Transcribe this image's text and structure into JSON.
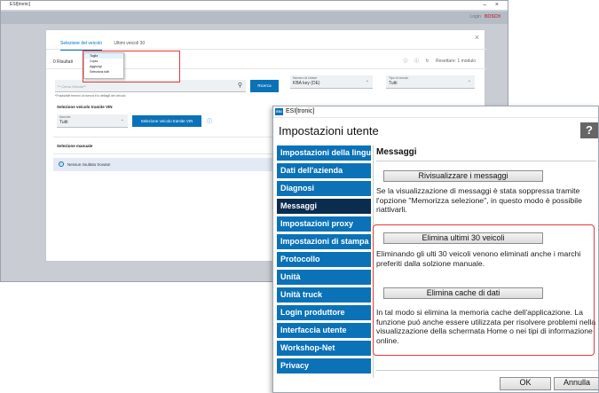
{
  "bg_window": {
    "title": "ESI[tronic]",
    "appbar_right": "Login",
    "brand": "BOSCH",
    "dialog": {
      "tabs": [
        "Selezione del veicolo",
        "Ultimi veicoli 30"
      ],
      "results": "0 Risultati",
      "reset_label": "Resettare: 1 modulo",
      "search_placeholder": "** Cerca Veicolo**",
      "search_hint": "*Posásibile termini di ricerca e/o dettagli del veicolo",
      "search_button": "Ricerca",
      "kba_label": "Numero di chiave",
      "kba_value": "KBA key (DE)",
      "type_label": "Tipo di veicolo",
      "type_value": "Tutti",
      "vin_section": "Selezione veicolo tramite VIN",
      "brand_label": "Marchio",
      "brand_value": "Tutti",
      "vin_button": "Selezione veicolo tramite VIN",
      "manual_section": "Selezione manuale",
      "no_result": "Nessun risultato trovato!",
      "context_menu": [
        "Taglia",
        "Copia",
        "Aggiungi",
        "Seleziona tutti"
      ]
    }
  },
  "settings": {
    "window_title": "ESI[tronic]",
    "app_icon": "ESI",
    "heading": "Impostazioni utente",
    "help": "?",
    "nav": [
      {
        "label": "Impostazioni della lingua",
        "active": false
      },
      {
        "label": "Dati dell'azienda",
        "active": false
      },
      {
        "label": "Diagnosi",
        "active": false
      },
      {
        "label": "Messaggi",
        "active": true
      },
      {
        "label": "Impostazioni proxy",
        "active": false
      },
      {
        "label": "Impostazioni di stampa",
        "active": false
      },
      {
        "label": "Protocollo",
        "active": false
      },
      {
        "label": "Unità",
        "active": false
      },
      {
        "label": "Unità truck",
        "active": false
      },
      {
        "label": "Login produttore",
        "active": false
      },
      {
        "label": "Interfaccia utente",
        "active": false
      },
      {
        "label": "Workshop-Net",
        "active": false
      },
      {
        "label": "Privacy",
        "active": false
      }
    ],
    "content": {
      "title": "Messaggi",
      "btn_show_messages": "Rivisualizzare i messaggi",
      "desc_show_messages": "Se la visualizzazione di messaggi è stata soppressa tramite l'opzione \"Memorizza selezione\", in questo modo è possibile riattivarli.",
      "btn_delete_vehicles": "Elimina ultimi 30 veicoli",
      "desc_delete_vehicles": "Eliminando gli ulti 30 veicoli venono eliminati anche i marchi preferiti dalla solzione manuale.",
      "btn_delete_cache": "Elimina cache di dati",
      "desc_delete_cache": "In tal modo si elimina la memoria cache dell'applicazione. La funzione puó anche essere utilizzata per risolvere problemi nella visualizzazione della schermata Home o nei tipi di informazione online."
    },
    "ok": "OK",
    "cancel": "Annulla"
  },
  "colors": {
    "accent": "#0b72b7",
    "nav_active": "#0a2c4f",
    "highlight": "#e23a3a"
  }
}
